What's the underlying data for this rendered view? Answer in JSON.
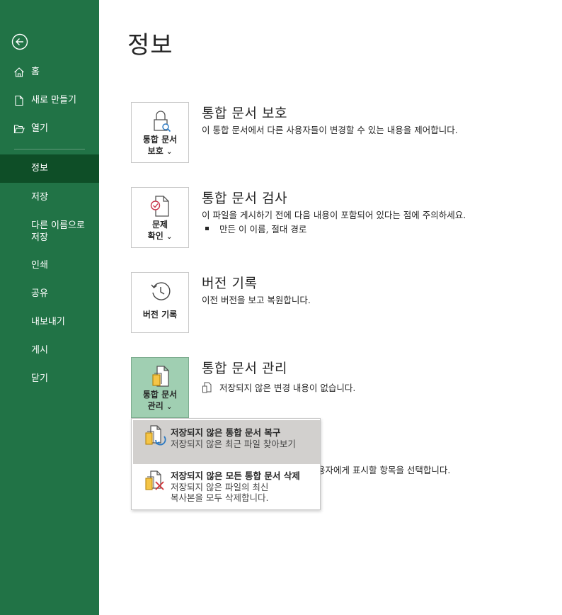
{
  "sidebar": {
    "items": [
      {
        "label": "홈",
        "icon": "home-icon"
      },
      {
        "label": "새로 만들기",
        "icon": "new-document-icon"
      },
      {
        "label": "열기",
        "icon": "open-folder-icon"
      },
      {
        "label": "정보"
      },
      {
        "label": "저장"
      },
      {
        "label": "다른 이름으로 저장"
      },
      {
        "label": "인쇄"
      },
      {
        "label": "공유"
      },
      {
        "label": "내보내기"
      },
      {
        "label": "게시"
      },
      {
        "label": "닫기"
      }
    ],
    "back_icon": "back-arrow-icon",
    "active_item": "정보",
    "colors": {
      "background": "#217346",
      "active": "#0e4e27"
    }
  },
  "main": {
    "title": "정보",
    "sections": [
      {
        "tile_line1": "통합 문서",
        "tile_line2": "보호",
        "tile_chevron": "⌄",
        "icon": "lock-icon",
        "title": "통합 문서 보호",
        "description": "이 통합 문서에서 다른 사용자들이 변경할 수 있는 내용을 제어합니다."
      },
      {
        "tile_line1": "문제",
        "tile_line2": "확인",
        "tile_chevron": "⌄",
        "icon": "inspect-document-icon",
        "title": "통합 문서 검사",
        "description": "이 파일을 게시하기 전에 다음 내용이 포함되어 있다는 점에 주의하세요.",
        "bullet": "만든 이 이름, 절대 경로"
      },
      {
        "tile_line1": "버전 기록",
        "icon": "version-history-icon",
        "title": "버전 기록",
        "description": "이전 버전을 보고 복원합니다."
      },
      {
        "tile_line1": "통합 문서",
        "tile_line2": "관리",
        "tile_chevron": "⌄",
        "icon": "manage-workbook-icon",
        "title": "통합 문서 관리",
        "status": "저장되지 않은 변경 내용이 없습니다.",
        "status_icon": "document-status-icon"
      }
    ],
    "partially_hidden_text": "용자에게 표시할 항목을 선택합니다."
  },
  "dropdown": {
    "items": [
      {
        "title": "저장되지 않은 통합 문서 복구",
        "description": "저장되지 않은 최근 파일 찾아보기",
        "icon": "recover-unsaved-icon"
      },
      {
        "title": "저장되지 않은 모든 통합 문서 삭제",
        "description_line1": "저장되지 않은 파일의 최신",
        "description_line2": "복사본을 모두 삭제합니다.",
        "icon": "delete-unsaved-icon"
      }
    ]
  }
}
